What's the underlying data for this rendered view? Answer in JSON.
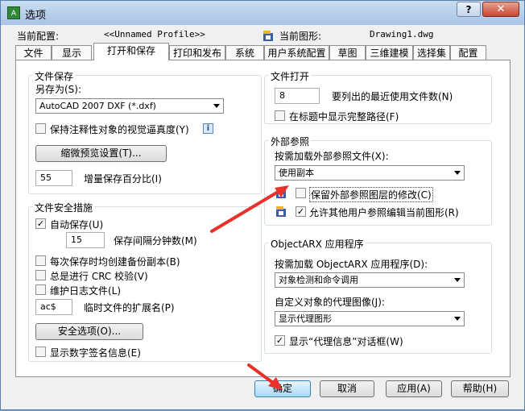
{
  "window": {
    "title": "选项",
    "help_button": "?",
    "close_button": "✕"
  },
  "header": {
    "current_config_label": "当前配置:",
    "current_config_value": "<<Unnamed Profile>>",
    "current_drawing_label": "当前图形:",
    "current_drawing_value": "Drawing1.dwg"
  },
  "tabs": [
    "文件",
    "显示",
    "打开和保存",
    "打印和发布",
    "系统",
    "用户系统配置",
    "草图",
    "三维建模",
    "选择集",
    "配置"
  ],
  "active_tab": "打开和保存",
  "file_save": {
    "title": "文件保存",
    "save_as_label": "另存为(S):",
    "save_as_value": "AutoCAD 2007 DXF (*.dxf)",
    "maintain_visual_fidelity_label": "保持注释性对象的视觉逼真度(Y)",
    "maintain_visual_fidelity_checked": false,
    "thumbnail_button": "缩微预览设置(T)...",
    "incremental_save_value": "55",
    "incremental_save_label": "增量保存百分比(I)"
  },
  "file_safety": {
    "title": "文件安全措施",
    "autosave_label": "自动保存(U)",
    "autosave_checked": true,
    "minutes_value": "15",
    "minutes_label": "保存间隔分钟数(M)",
    "backup_label": "每次保存时均创建备份副本(B)",
    "backup_checked": false,
    "crc_label": "总是进行 CRC 校验(V)",
    "crc_checked": false,
    "log_label": "维护日志文件(L)",
    "log_checked": false,
    "temp_ext_value": "ac$",
    "temp_ext_label": "临时文件的扩展名(P)",
    "security_button": "安全选项(O)...",
    "digital_signature_label": "显示数字签名信息(E)",
    "digital_signature_checked": false
  },
  "file_open": {
    "title": "文件打开",
    "recent_count_value": "8",
    "recent_count_label": "要列出的最近使用文件数(N)",
    "full_path_label": "在标题中显示完整路径(F)",
    "full_path_checked": false
  },
  "xref": {
    "title": "外部参照",
    "demand_load_label": "按需加载外部参照文件(X):",
    "demand_load_value": "使用副本",
    "retain_changes_label": "保留外部参照图层的修改(C)",
    "retain_changes_checked": false,
    "allow_edit_label": "允许其他用户参照编辑当前图形(R)",
    "allow_edit_checked": true
  },
  "objectarx": {
    "title": "ObjectARX 应用程序",
    "demand_load_label": "按需加载 ObjectARX 应用程序(D):",
    "demand_load_value": "对象检测和命令调用",
    "proxy_images_label": "自定义对象的代理图像(J):",
    "proxy_images_value": "显示代理图形",
    "proxy_dialog_label": "显示“代理信息”对话框(W)",
    "proxy_dialog_checked": true
  },
  "footer": {
    "ok": "确定",
    "cancel": "取消",
    "apply": "应用(A)",
    "help": "帮助(H)"
  },
  "annotations": {
    "arrow_color": "#e8312a"
  }
}
